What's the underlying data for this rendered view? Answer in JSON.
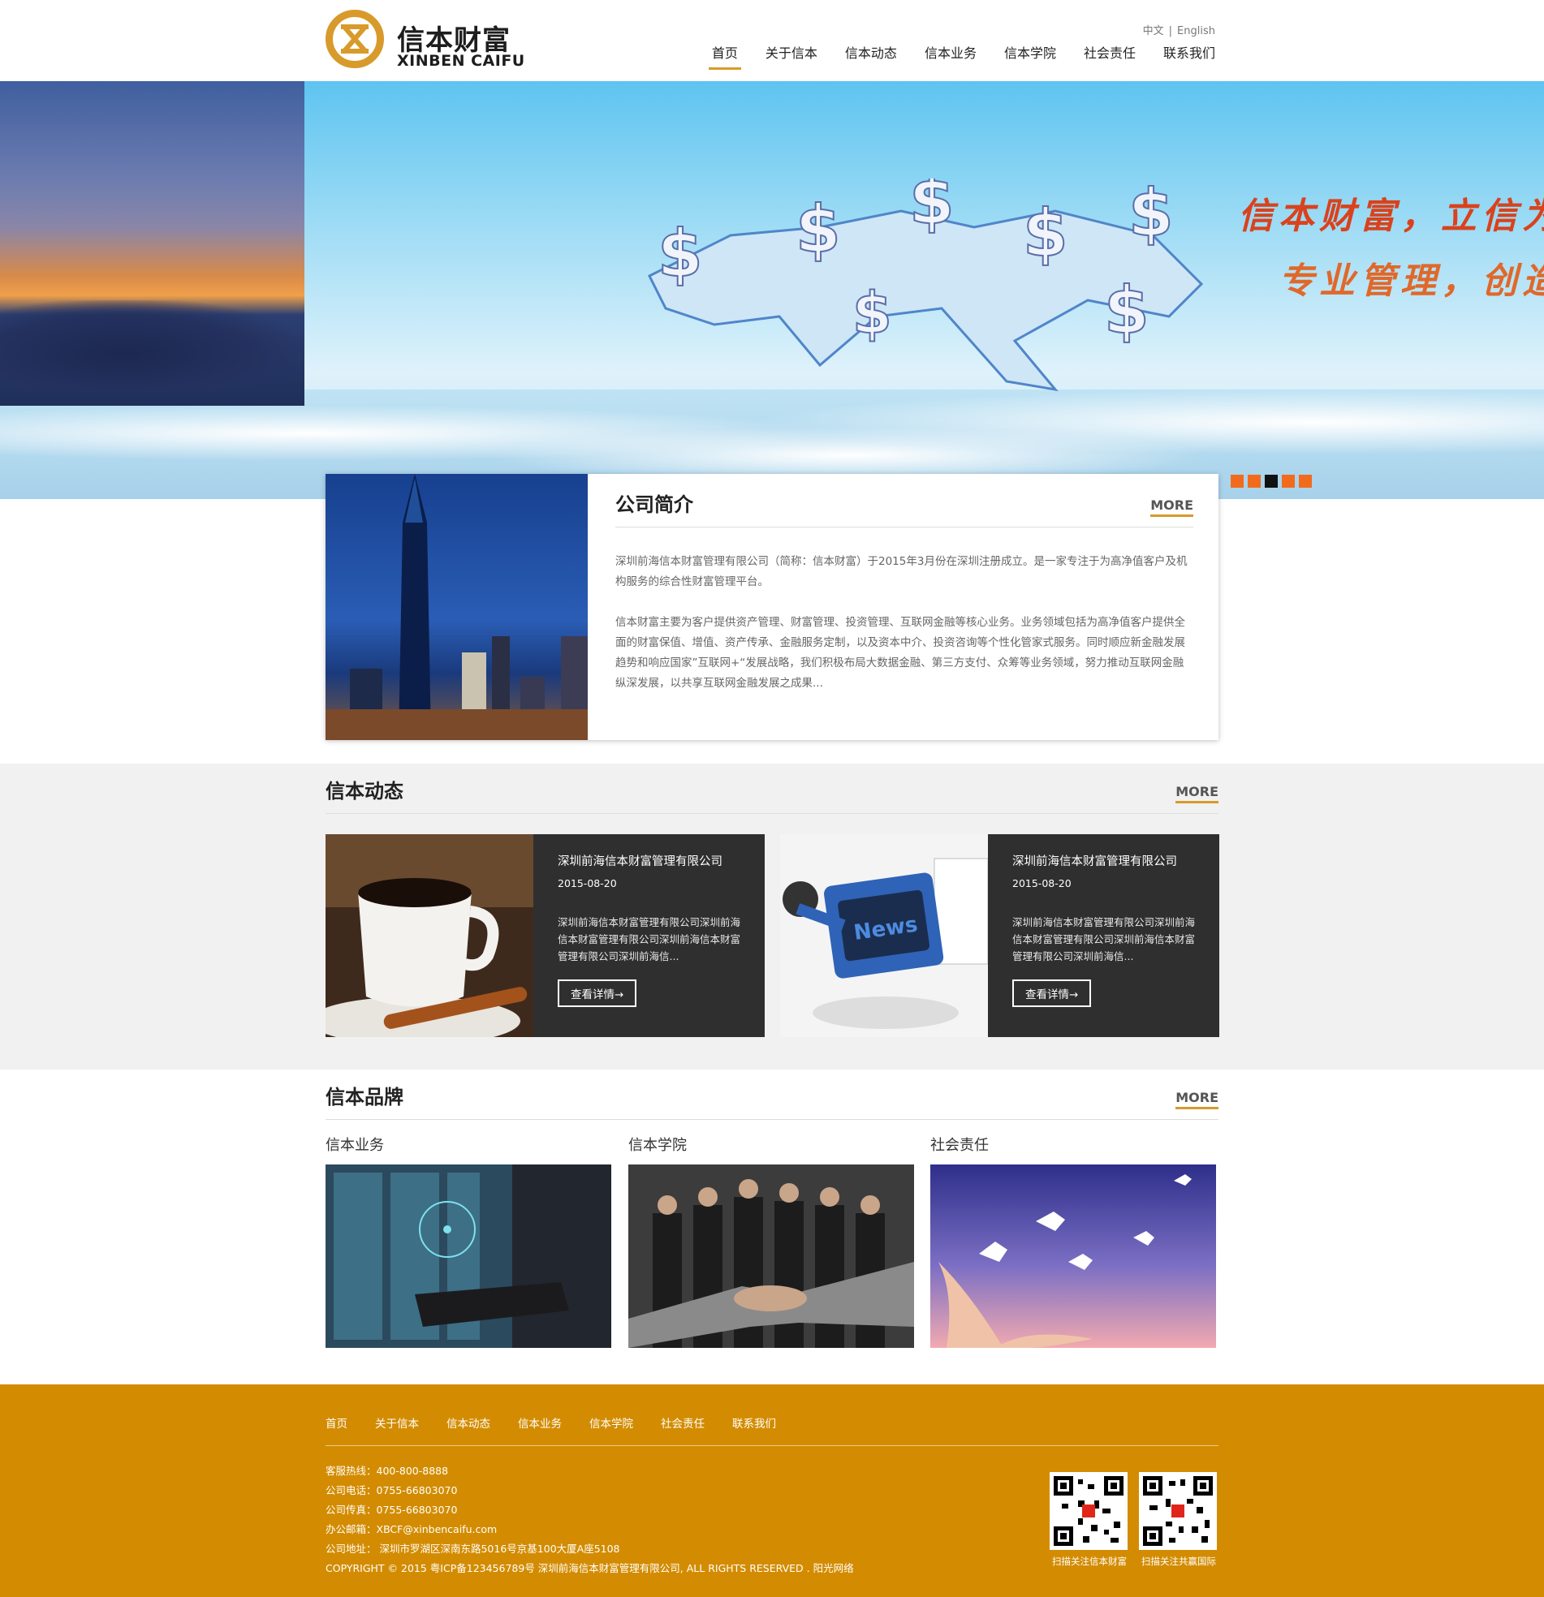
{
  "brand": {
    "name_cn": "信本财富",
    "name_en": "XINBEN CAIFU",
    "accent": "#d89a2a"
  },
  "lang": {
    "cn": "中文",
    "sep": "|",
    "en": "English"
  },
  "nav": [
    "首页",
    "关于信本",
    "信本动态",
    "信本业务",
    "信本学院",
    "社会责任",
    "联系我们"
  ],
  "banner": {
    "slogan_line1": "信本财富，立信为",
    "slogan_line2": "专业管理，创造",
    "dots": 5,
    "active_dot": 3
  },
  "intro": {
    "title": "公司简介",
    "more": "MORE",
    "paragraph1": "深圳前海信本财富管理有限公司（简称：信本财富）于2015年3月份在深圳注册成立。是一家专注于为高净值客户及机构服务的综合性财富管理平台。",
    "paragraph2": "信本财富主要为客户提供资产管理、财富管理、投资管理、互联网金融等核心业务。业务领域包括为高净值客户提供全面的财富保值、增值、资产传承、金融服务定制，以及资本中介、投资咨询等个性化管家式服务。同时顺应新金融发展趋势和响应国家”互联网+“发展战略，我们积极布局大数据金融、第三方支付、众筹等业务领域，努力推动互联网金融纵深发展，以共享互联网金融发展之成果..."
  },
  "news": {
    "title": "信本动态",
    "more": "MORE",
    "items": [
      {
        "title": "深圳前海信本财富管理有限公司",
        "date": "2015-08-20",
        "desc": "深圳前海信本财富管理有限公司深圳前海信本财富管理有限公司深圳前海信本财富管理有限公司深圳前海信...",
        "button": "查看详情→"
      },
      {
        "title": "深圳前海信本财富管理有限公司",
        "date": "2015-08-20",
        "desc": "深圳前海信本财富管理有限公司深圳前海信本财富管理有限公司深圳前海信本财富管理有限公司深圳前海信...",
        "button": "查看详情→"
      }
    ]
  },
  "brands": {
    "title": "信本品牌",
    "more": "MORE",
    "items": [
      "信本业务",
      "信本学院",
      "社会责任"
    ]
  },
  "footer": {
    "nav": [
      "首页",
      "关于信本",
      "信本动态",
      "信本业务",
      "信本学院",
      "社会责任",
      "联系我们"
    ],
    "hotline": "客服热线：400-800-8888",
    "phone": "公司电话：0755-66803070",
    "fax": "公司传真：0755-66803070",
    "email": "办公邮箱：XBCF@xinbencaifu.com",
    "address": "公司地址： 深圳市罗湖区深南东路5016号京基100大厦A座5108",
    "copyright": "COPYRIGHT © 2015 粤ICP备123456789号 深圳前海信本财富管理有限公司, ALL RIGHTS RESERVED . 阳光网络",
    "qr1": "扫描关注信本财富",
    "qr2": "扫描关注共赢国际",
    "bg": "#d38c01"
  }
}
